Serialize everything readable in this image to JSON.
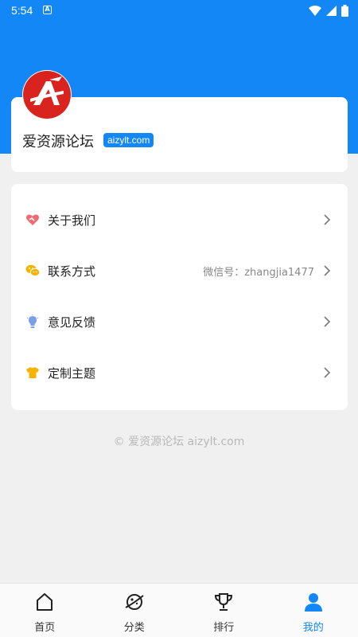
{
  "status_bar": {
    "time": "5:54",
    "notification_icon": "A"
  },
  "profile": {
    "name": "爱资源论坛",
    "domain_badge": "aizylt.com"
  },
  "menu": [
    {
      "label": "关于我们",
      "value": "",
      "icon": "heart-hands-icon",
      "color": "#ef6b73"
    },
    {
      "label": "联系方式",
      "value": "微信号：zhangjia1477",
      "icon": "wechat-icon",
      "color": "#f5b400"
    },
    {
      "label": "意见反馈",
      "value": "",
      "icon": "lightbulb-icon",
      "color": "#7a9ee8"
    },
    {
      "label": "定制主题",
      "value": "",
      "icon": "tshirt-icon",
      "color": "#f5b400"
    }
  ],
  "footer": {
    "copyright": "© 爱资源论坛 aizylt.com"
  },
  "bottom_nav": [
    {
      "label": "首页",
      "icon": "home-icon",
      "active": false
    },
    {
      "label": "分类",
      "icon": "planet-icon",
      "active": false
    },
    {
      "label": "排行",
      "icon": "trophy-icon",
      "active": false
    },
    {
      "label": "我的",
      "icon": "user-icon",
      "active": true
    }
  ],
  "colors": {
    "accent": "#1287f5",
    "background": "#f0f0f0"
  }
}
